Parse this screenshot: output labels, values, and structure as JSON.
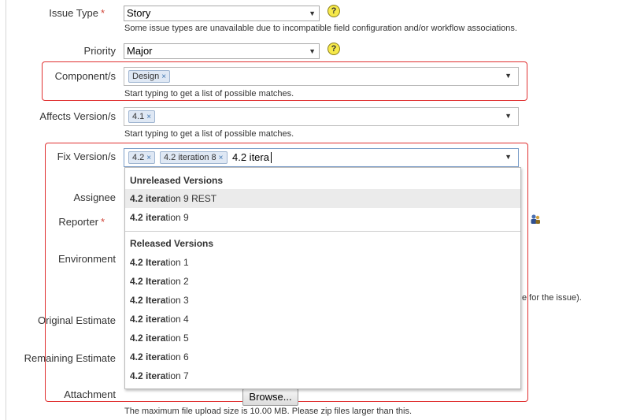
{
  "fields": {
    "issue_type": {
      "label": "Issue Type",
      "required_marker": "*",
      "value": "Story",
      "description": "Some issue types are unavailable due to incompatible field configuration and/or workflow associations."
    },
    "priority": {
      "label": "Priority",
      "value": "Major"
    },
    "components": {
      "label": "Component/s",
      "tokens": [
        {
          "text": "Design",
          "remove": "×"
        }
      ],
      "description": "Start typing to get a list of possible matches."
    },
    "affects_versions": {
      "label": "Affects Version/s",
      "tokens": [
        {
          "text": "4.1",
          "remove": "×"
        }
      ],
      "description": "Start typing to get a list of possible matches."
    },
    "fix_versions": {
      "label": "Fix Version/s",
      "tokens": [
        {
          "text": "4.2",
          "remove": "×"
        },
        {
          "text": "4.2 iteration 8",
          "remove": "×"
        }
      ],
      "input_value": "4.2 itera"
    },
    "assignee": {
      "label": "Assignee"
    },
    "reporter": {
      "label": "Reporter",
      "required_marker": "*"
    },
    "environment": {
      "label": "Environment"
    },
    "original_estimate": {
      "label": "Original Estimate"
    },
    "remaining_estimate": {
      "label": "Remaining Estimate"
    },
    "attachment": {
      "label": "Attachment",
      "browse_label": "Browse...",
      "description": "The maximum file upload size is 10.00 MB. Please zip files larger than this."
    }
  },
  "hidden_fragment": "e for the issue).",
  "dropdown": {
    "groups": [
      {
        "heading": "Unreleased Versions",
        "items": [
          {
            "match": "4.2 itera",
            "rest": "tion 9 REST",
            "active": true
          },
          {
            "match": "4.2 itera",
            "rest": "tion 9",
            "active": false
          }
        ]
      },
      {
        "heading": "Released Versions",
        "items": [
          {
            "match": "4.2 Itera",
            "rest": "tion 1"
          },
          {
            "match": "4.2 Itera",
            "rest": "tion 2"
          },
          {
            "match": "4.2 Itera",
            "rest": "tion 3"
          },
          {
            "match": "4.2 itera",
            "rest": "tion 4"
          },
          {
            "match": "4.2 itera",
            "rest": "tion 5"
          },
          {
            "match": "4.2 itera",
            "rest": "tion 6"
          },
          {
            "match": "4.2 itera",
            "rest": "tion 7"
          }
        ]
      }
    ]
  },
  "icons": {
    "help": "help-icon",
    "dropdown_arrow": "chevron-down-icon",
    "user_picker": "user-picker-icon",
    "remove": "close-icon"
  },
  "colors": {
    "highlight_border": "#e03030",
    "token_bg": "#dfe8f4",
    "token_border": "#9fb5d1",
    "required": "#d04437",
    "help_icon": "#f6e94a"
  }
}
